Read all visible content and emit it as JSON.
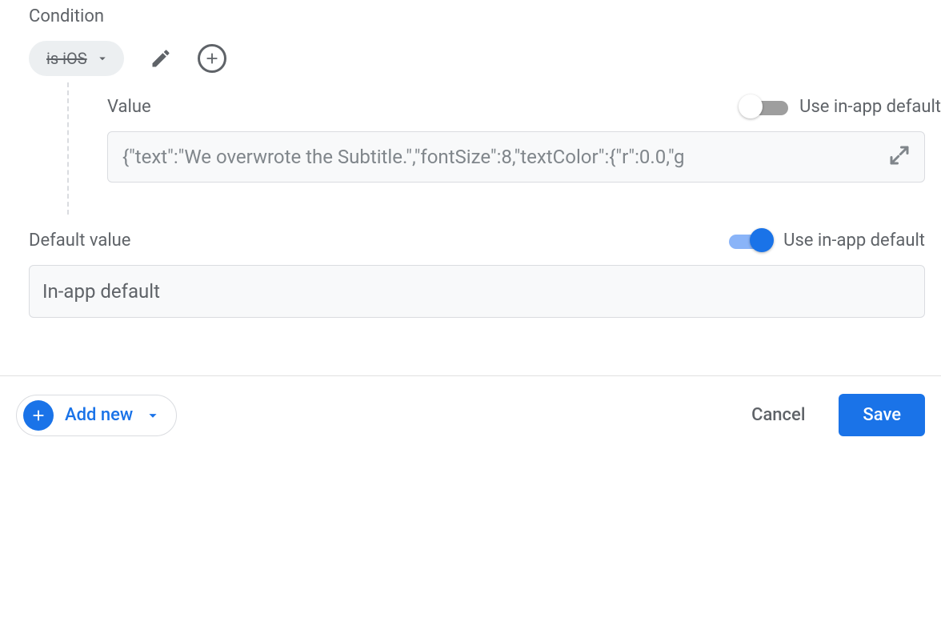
{
  "condition": {
    "section_label": "Condition",
    "chip_label": "is iOS",
    "value_label": "Value",
    "use_in_app_default_label": "Use in-app default",
    "value_toggle_on": false,
    "value_placeholder": "{\"text\":\"We overwrote the Subtitle.\",\"fontSize\":8,\"textColor\":{\"r\":0.0,\"g"
  },
  "default": {
    "section_label": "Default value",
    "use_in_app_default_label": "Use in-app default",
    "toggle_on": true,
    "value_text": "In-app default"
  },
  "footer": {
    "add_new_label": "Add new",
    "cancel_label": "Cancel",
    "save_label": "Save"
  }
}
